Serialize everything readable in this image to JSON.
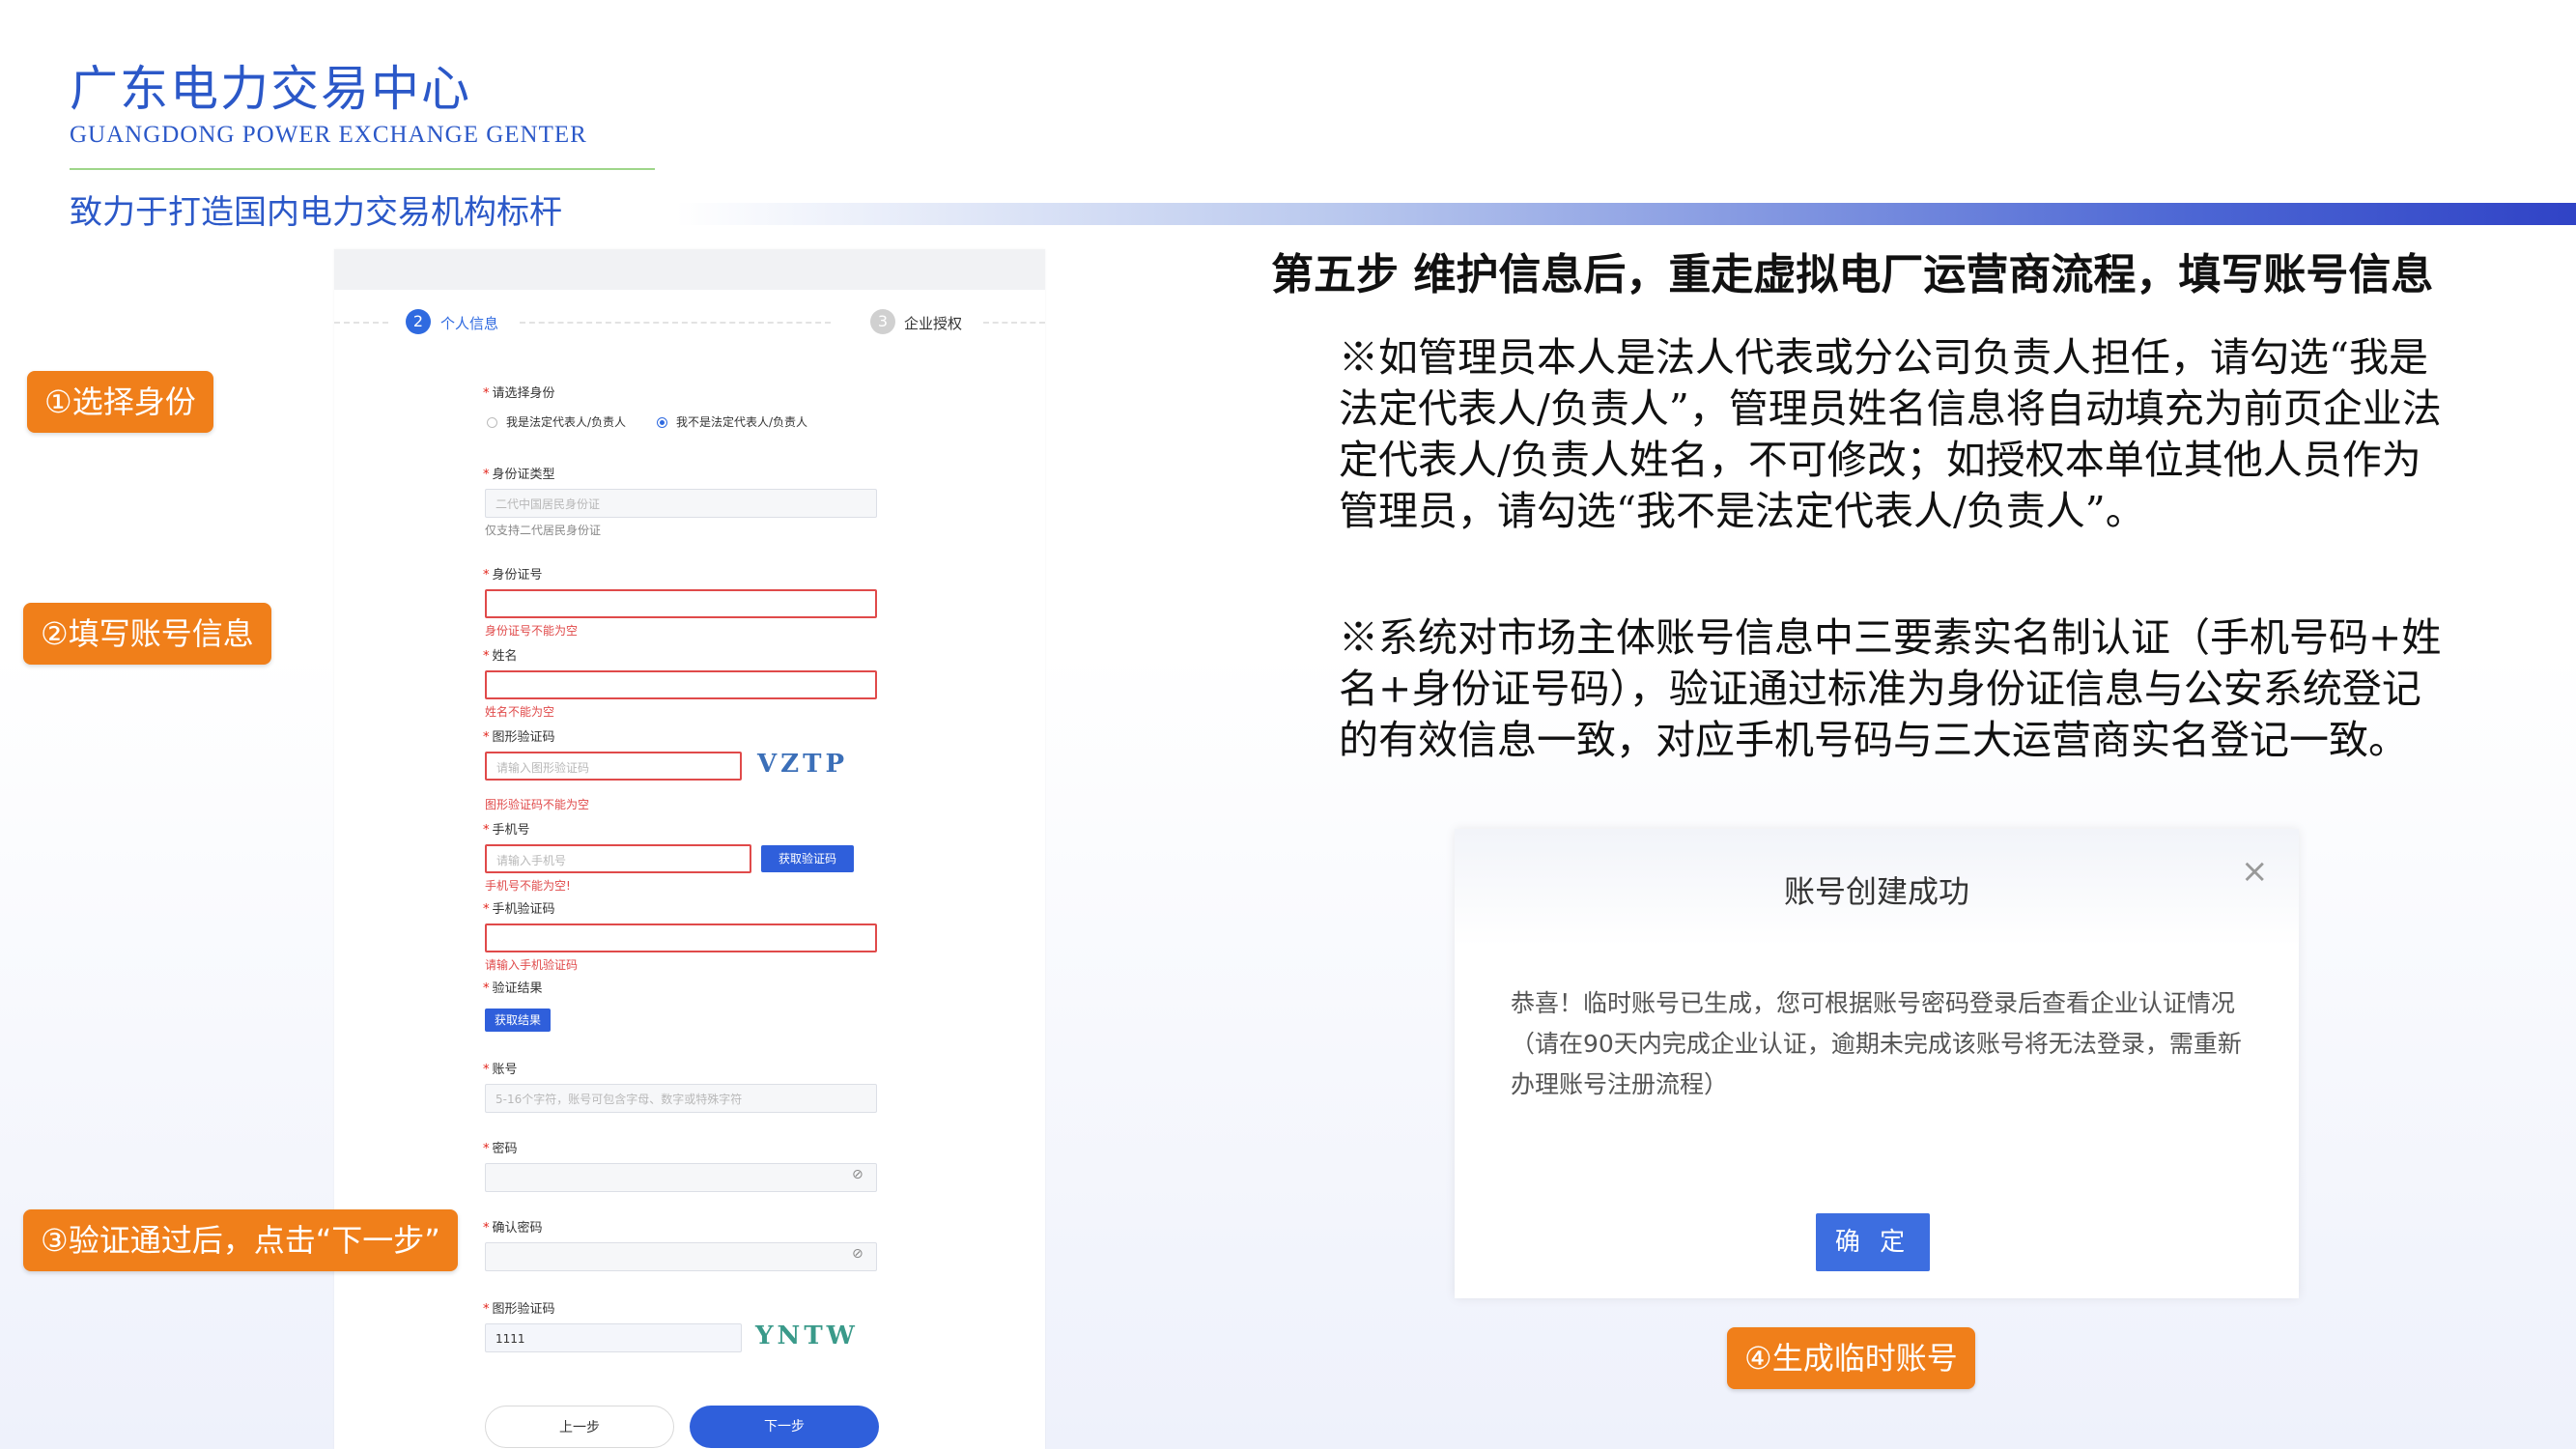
{
  "header": {
    "org_cn": "广东电力交易中心",
    "org_en": "GUANGDONG POWER EXCHANGE GENTER",
    "slogan": "致力于打造国内电力交易机构标杆"
  },
  "form": {
    "steps": [
      {
        "num": "2",
        "label": "个人信息",
        "active": true
      },
      {
        "num": "3",
        "label": "企业授权",
        "active": false
      }
    ],
    "identity": {
      "label": "请选择身份",
      "options": [
        "我是法定代表人/负责人",
        "我不是法定代表人/负责人"
      ],
      "selected": "我不是法定代表人/负责人"
    },
    "id_type": {
      "label": "身份证类型",
      "placeholder": "二代中国居民身份证",
      "hint": "仅支持二代居民身份证"
    },
    "id_number": {
      "label": "身份证号",
      "error": "身份证号不能为空"
    },
    "name": {
      "label": "姓名",
      "error": "姓名不能为空"
    },
    "captcha1": {
      "label": "图形验证码",
      "placeholder": "请输入图形验证码",
      "error": "图形验证码不能为空",
      "image_text": "VZTP"
    },
    "phone": {
      "label": "手机号",
      "placeholder": "请输入手机号",
      "button": "获取验证码",
      "error": "手机号不能为空!"
    },
    "sms_code": {
      "label": "手机验证码",
      "error": "请输入手机验证码"
    },
    "verify": {
      "label": "验证结果",
      "button": "获取结果"
    },
    "account": {
      "label": "账号",
      "placeholder": "5-16个字符，账号可包含字母、数字或特殊字符"
    },
    "password": {
      "label": "密码"
    },
    "confirm_password": {
      "label": "确认密码"
    },
    "captcha2": {
      "label": "图形验证码",
      "value": "1111",
      "image_text": "YNTW"
    },
    "prev_button": "上一步",
    "next_button": "下一步",
    "eye_icon": "eye-slash-icon"
  },
  "callouts": {
    "c1": "①选择身份",
    "c2": "②填写账号信息",
    "c3": "③验证通过后，点击“下一步”",
    "c4": "④生成临时账号"
  },
  "content": {
    "step_title": "第五步  维护信息后，重走虚拟电厂运营商流程，填写账号信息",
    "note1": "※如管理员本人是法人代表或分公司负责人担任，请勾选“我是法定代表人/负责人”，管理员姓名信息将自动填充为前页企业法定代表人/负责人姓名，不可修改；如授权本单位其他人员作为管理员，请勾选“我不是法定代表人/负责人”。",
    "note2": "※系统对市场主体账号信息中三要素实名制认证（手机号码+姓名+身份证号码），验证通过标准为身份证信息与公安系统登记的有效信息一致，对应手机号码与三大运营商实名登记一致。"
  },
  "dialog": {
    "title": "账号创建成功",
    "close": "×",
    "message": "恭喜！临时账号已生成，您可根据账号密码登录后查看企业认证情况",
    "note": "（请在90天内完成企业认证，逾期未完成该账号将无法登录，需重新办理账号注册流程）",
    "ok_button": "确 定"
  },
  "colors": {
    "brand_blue": "#2b58c8",
    "callout_orange": "#f07f1a",
    "button_blue": "#2f5fdb",
    "error_red": "#e04a4a"
  }
}
